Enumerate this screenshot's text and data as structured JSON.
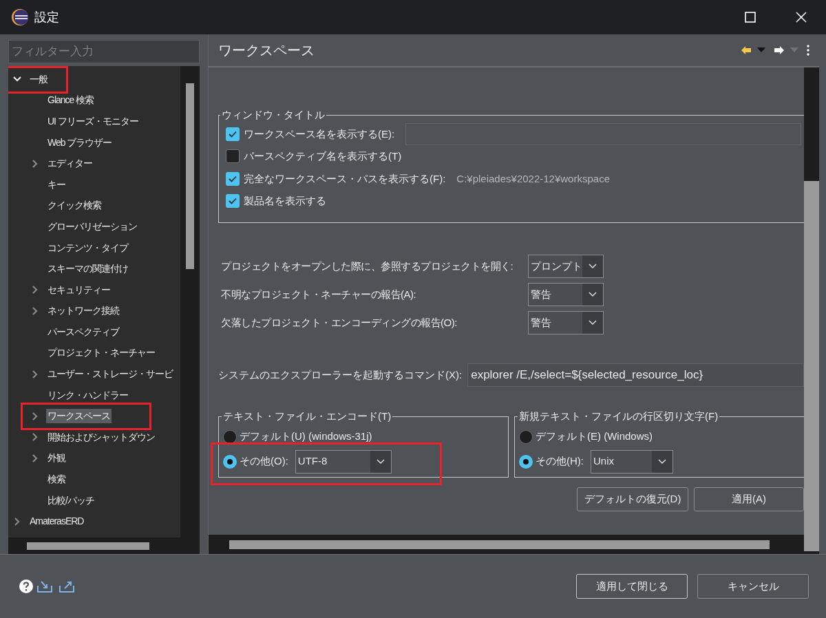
{
  "window": {
    "title": "設定"
  },
  "filter": {
    "placeholder": "フィルター入力"
  },
  "tree": [
    {
      "label": "一般",
      "expanded": true,
      "selected": false,
      "highlighted": true,
      "children": [
        {
          "label": "Glance 検索",
          "selected": false
        },
        {
          "label": "UI フリーズ・モニター",
          "selected": false
        },
        {
          "label": "Web ブラウザー",
          "selected": false
        },
        {
          "label": "エディター",
          "expanded": false,
          "selected": false
        },
        {
          "label": "キー",
          "selected": false
        },
        {
          "label": "クイック検索",
          "selected": false
        },
        {
          "label": "グローバリゼーション",
          "selected": false
        },
        {
          "label": "コンテンツ・タイプ",
          "selected": false
        },
        {
          "label": "スキーマの関連付け",
          "selected": false
        },
        {
          "label": "セキュリティー",
          "expanded": false,
          "selected": false
        },
        {
          "label": "ネットワーク接続",
          "expanded": false,
          "selected": false
        },
        {
          "label": "パースペクティブ",
          "selected": false
        },
        {
          "label": "プロジェクト・ネーチャー",
          "selected": false
        },
        {
          "label": "ユーザー・ストレージ・サービ",
          "expanded": false,
          "selected": false
        },
        {
          "label": "リンク・ハンドラー",
          "selected": false
        },
        {
          "label": "ワークスペース",
          "expanded": false,
          "selected": true,
          "highlighted": true
        },
        {
          "label": "開始およびシャットダウン",
          "expanded": false,
          "selected": false
        },
        {
          "label": "外観",
          "expanded": false,
          "selected": false
        },
        {
          "label": "検索",
          "selected": false
        },
        {
          "label": "比較/パッチ",
          "selected": false
        }
      ]
    },
    {
      "label": "AmaterasERD",
      "expanded": false,
      "selected": false
    }
  ],
  "page": {
    "title": "ワークスペース"
  },
  "window_title_group": {
    "legend": "ウィンドウ・タイトル",
    "options": [
      {
        "kind": "field",
        "label": "ワークスペース名を表示する(E):",
        "checked": true
      },
      {
        "kind": "plain",
        "label": "パースペクティブ名を表示する(T)",
        "checked": false
      },
      {
        "kind": "path",
        "label": "完全なワークスペース・パスを表示する(F):",
        "checked": true,
        "value": "C:¥pleiades¥2022-12¥workspace"
      },
      {
        "kind": "plain",
        "label": "製品名を表示する",
        "checked": true
      }
    ]
  },
  "dropdown_settings": [
    {
      "label": "プロジェクトをオープンした際に、参照するプロジェクトを開く:",
      "value": "プロンプト"
    },
    {
      "label": "不明なプロジェクト・ネーチャーの報告(A):",
      "value": "警告"
    },
    {
      "label": "欠落したプロジェクト・エンコーディングの報告(O):",
      "value": "警告"
    }
  ],
  "command": {
    "label": "システムのエクスプローラーを起動するコマンド(X):",
    "value": "explorer /E,/select=${selected_resource_loc}"
  },
  "radio_groups": [
    {
      "legend": "テキスト・ファイル・エンコード(T)",
      "options": [
        {
          "label": "デフォルト(U) (windows-31j)",
          "selected": false
        },
        {
          "label": "その他(O):",
          "selected": true,
          "value": "UTF-8",
          "highlighted": true
        }
      ]
    },
    {
      "legend": "新規テキスト・ファイルの行区切り文字(F)",
      "options": [
        {
          "label": "デフォルト(E) (Windows)",
          "selected": false
        },
        {
          "label": "その他(H):",
          "selected": true,
          "value": "Unix"
        }
      ]
    }
  ],
  "page_buttons": [
    "デフォルトの復元(D)",
    "適用(A)"
  ],
  "dialog_buttons": [
    "適用して閉じる",
    "キャンセル"
  ]
}
